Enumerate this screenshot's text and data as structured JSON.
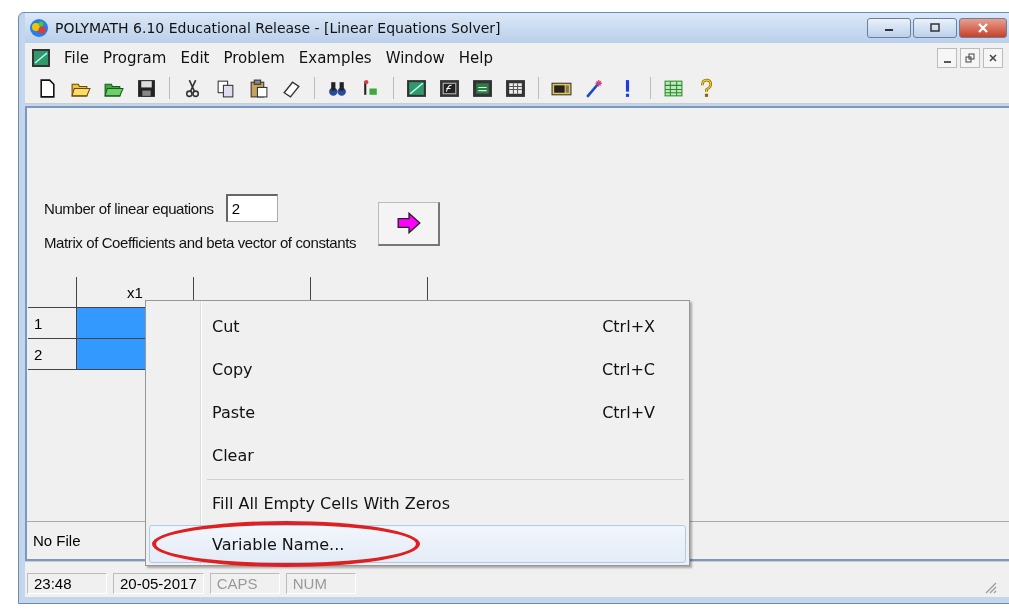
{
  "window": {
    "title": "POLYMATH 6.10 Educational Release - [Linear Equations Solver]"
  },
  "menu_bar": [
    "File",
    "Program",
    "Edit",
    "Problem",
    "Examples",
    "Window",
    "Help"
  ],
  "form": {
    "equations_label": "Number of linear equations",
    "equations_value": "2",
    "matrix_label": "Matrix of Coefficients and beta vector of constants"
  },
  "table": {
    "columns": [
      "x1",
      "",
      ""
    ],
    "rows": [
      {
        "label": "1",
        "selected": true
      },
      {
        "label": "2",
        "selected": true
      }
    ]
  },
  "child_status": "No File",
  "context_menu": [
    {
      "kind": "item",
      "label": "Cut",
      "shortcut": "Ctrl+X",
      "selected": false
    },
    {
      "kind": "item",
      "label": "Copy",
      "shortcut": "Ctrl+C",
      "selected": false
    },
    {
      "kind": "item",
      "label": "Paste",
      "shortcut": "Ctrl+V",
      "selected": false
    },
    {
      "kind": "item",
      "label": "Clear",
      "selected": false
    },
    {
      "kind": "separator"
    },
    {
      "kind": "item",
      "label": "Fill All Empty Cells With Zeros",
      "selected": false
    },
    {
      "kind": "item",
      "label": "Variable Name...",
      "selected": true,
      "circled": true
    }
  ],
  "status_bar": [
    "23:48",
    "20-05-2017",
    "CAPS",
    "NUM"
  ]
}
